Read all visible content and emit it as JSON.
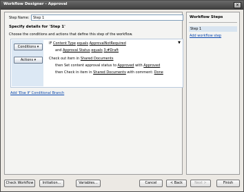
{
  "window": {
    "title": "Workflow Designer - Approval",
    "close_label": "✕"
  },
  "step": {
    "label": "Step Name:",
    "value": "Step 1"
  },
  "details": {
    "header": "Specify details for 'Step 1'",
    "sub": "Choose the conditions and actions that define this step of the workflow."
  },
  "buttons": {
    "conditions": "Conditions ▾",
    "actions": "Actions ▾"
  },
  "condition": {
    "if": "IF",
    "field1": "Content Type",
    "op1": "equals",
    "val1": "ApprovalNotRequired",
    "and": "and",
    "field2": "Approval Status",
    "op2": "equals",
    "val2": "3;#Draft"
  },
  "actions": {
    "line1_text": "Check out item in",
    "line1_link": "Shared Documents",
    "line2_pre": "then Set content approval status to",
    "line2_link1": "Approved",
    "line2_mid": "with",
    "line2_link2": "Approved",
    "line3_pre": "then Check in item in",
    "line3_link1": "Shared Documents",
    "line3_mid": "with comment:",
    "line3_link2": "Done"
  },
  "add_else": "Add 'Else If' Conditional Branch",
  "steps_panel": {
    "title": "Workflow Steps",
    "items": [
      "Step 1"
    ],
    "add_link": "Add workflow step"
  },
  "footer": {
    "check": "Check Workflow",
    "initiation": "Initiation...",
    "variables": "Variables...",
    "cancel": "Cancel",
    "back": "< Back",
    "next": "Next >",
    "finish": "Finish"
  }
}
